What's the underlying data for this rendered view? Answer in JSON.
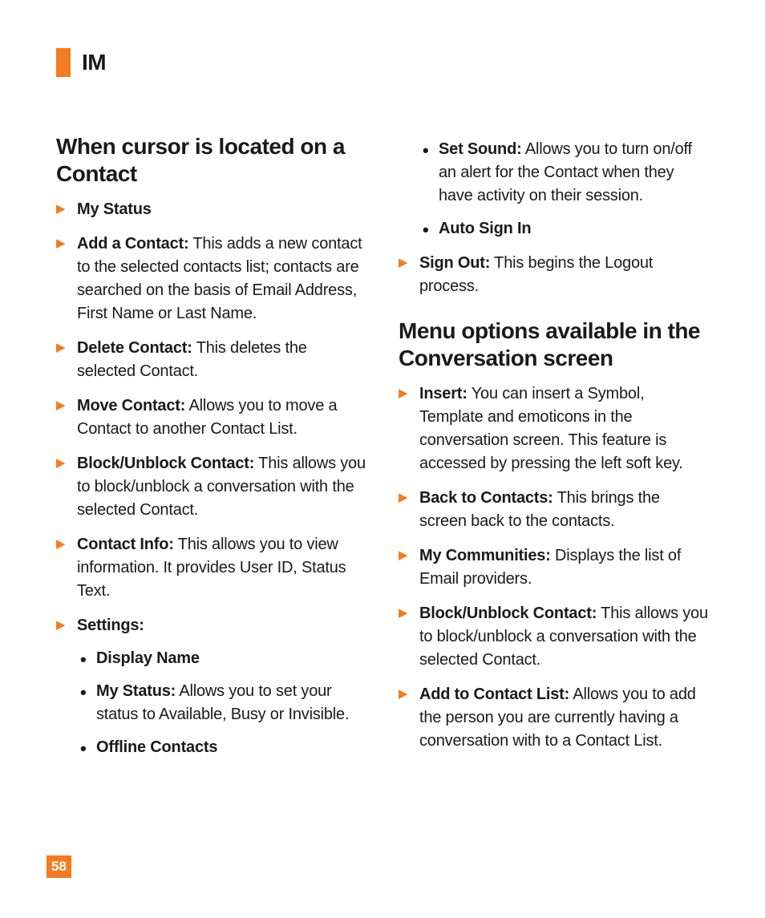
{
  "header": {
    "title": "IM"
  },
  "page_number": "58",
  "section1": {
    "heading": "When cursor is located on a Contact",
    "items": [
      {
        "label": "My Status",
        "text": ""
      },
      {
        "label": "Add a Contact:",
        "text": " This adds a new contact to the selected contacts list; contacts are searched on the basis of Email Address, First Name or Last Name."
      },
      {
        "label": "Delete Contact:",
        "text": " This deletes the selected Contact."
      },
      {
        "label": "Move Contact:",
        "text": " Allows you to move a Contact to another Contact List."
      },
      {
        "label": "Block/Unblock Contact:",
        "text": " This allows you to block/unblock a conversation with the selected Contact."
      },
      {
        "label": "Contact Info:",
        "text": " This allows you to view information. It provides User ID, Status Text."
      },
      {
        "label": "Settings:",
        "text": ""
      }
    ],
    "settings_sub": [
      {
        "label": "Display Name",
        "text": ""
      },
      {
        "label": "My Status:",
        "text": " Allows you to set your status to Available, Busy or Invisible."
      },
      {
        "label": "Offline Contacts",
        "text": ""
      }
    ]
  },
  "col2_top_sub": [
    {
      "label": "Set Sound:",
      "text": " Allows you to turn on/off an alert for the Contact when they have activity on their session."
    },
    {
      "label": "Auto Sign In",
      "text": ""
    }
  ],
  "col2_top_item": {
    "label": "Sign Out:",
    "text": " This begins the Logout process."
  },
  "section2": {
    "heading": "Menu options available in the Conversation screen",
    "items": [
      {
        "label": "Insert:",
        "text": " You can insert a Symbol, Template and emoticons in the conversation screen. This feature is accessed by pressing the left soft key."
      },
      {
        "label": "Back to Contacts:",
        "text": " This brings the screen back to the contacts."
      },
      {
        "label": "My Communities:",
        "text": " Displays the list of Email providers."
      },
      {
        "label": "Block/Unblock Contact:",
        "text": " This allows you to block/unblock a conversation with the selected Contact."
      },
      {
        "label": "Add to Contact List:",
        "text": " Allows you to add the person you are currently having a conversation with to a Contact List."
      }
    ]
  }
}
